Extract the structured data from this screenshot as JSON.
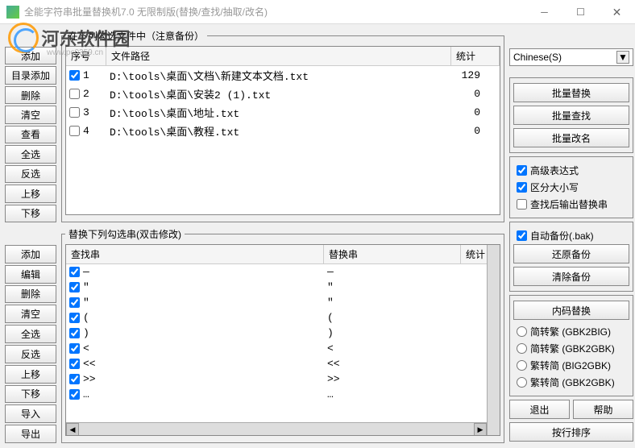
{
  "window": {
    "title": "全能字符串批量替换机7.0 无限制版(替换/查找/抽取/改名)"
  },
  "watermark": {
    "text": "河东软件园",
    "url": "www.pc0359.cn"
  },
  "fileSection": {
    "legend": "在下列勾选文件中（注意备份）",
    "header_seq": "序号",
    "header_path": "文件路径",
    "header_stat": "统计",
    "rows": [
      {
        "checked": true,
        "seq": "1",
        "path": "D:\\tools\\桌面\\文档\\新建文本文档.txt",
        "stat": "129"
      },
      {
        "checked": false,
        "seq": "2",
        "path": "D:\\tools\\桌面\\安装2 (1).txt",
        "stat": "0"
      },
      {
        "checked": false,
        "seq": "3",
        "path": "D:\\tools\\桌面\\地址.txt",
        "stat": "0"
      },
      {
        "checked": false,
        "seq": "4",
        "path": "D:\\tools\\桌面\\教程.txt",
        "stat": "0"
      }
    ]
  },
  "fileButtons": {
    "add": "添加",
    "addDir": "目录添加",
    "delete": "删除",
    "clear": "清空",
    "view": "查看",
    "selectAll": "全选",
    "invert": "反选",
    "moveUp": "上移",
    "moveDown": "下移"
  },
  "ruleSection": {
    "legend": "替换下列勾选串(双击修改)",
    "header_find": "查找串",
    "header_repl": "替换串",
    "header_stat": "统计",
    "rows": [
      {
        "find": "—",
        "repl": "—",
        "stat": ""
      },
      {
        "find": "\"",
        "repl": "\"",
        "stat": ""
      },
      {
        "find": "\"",
        "repl": "\"",
        "stat": ""
      },
      {
        "find": "(",
        "repl": "(",
        "stat": ""
      },
      {
        "find": ")",
        "repl": ")",
        "stat": ""
      },
      {
        "find": "<",
        "repl": "<",
        "stat": ""
      },
      {
        "find": "<<",
        "repl": "<<",
        "stat": ""
      },
      {
        "find": ">>",
        "repl": ">>",
        "stat": ""
      },
      {
        "find": "…",
        "repl": "…",
        "stat": ""
      }
    ]
  },
  "ruleButtons": {
    "add": "添加",
    "edit": "编辑",
    "delete": "删除",
    "clear": "清空",
    "selectAll": "全选",
    "invert": "反选",
    "moveUp": "上移",
    "moveDown": "下移",
    "import": "导入",
    "export": "导出"
  },
  "right": {
    "language": "Chinese(S)",
    "batch_replace": "批量替换",
    "batch_find": "批量查找",
    "batch_rename": "批量改名",
    "adv_expr": "高级表达式",
    "case_sens": "区分大小写",
    "output_after": "查找后输出替换串",
    "auto_backup": "自动备份(.bak)",
    "restore_backup": "还原备份",
    "clear_backup": "清除备份",
    "encoding_title": "内码替换",
    "enc1": "简转繁 (GBK2BIG)",
    "enc2": "简转繁 (GBK2GBK)",
    "enc3": "繁转简 (BIG2GBK)",
    "enc4": "繁转简 (GBK2GBK)",
    "exit": "退出",
    "help": "帮助",
    "sort_by_line": "按行排序"
  }
}
